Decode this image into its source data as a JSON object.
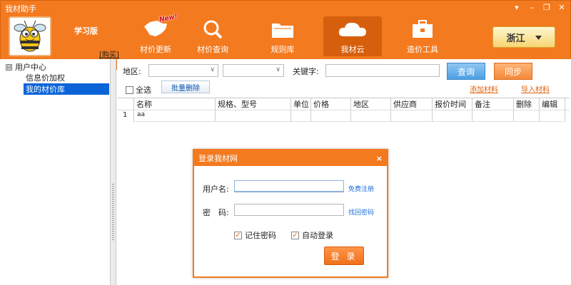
{
  "app": {
    "title": "我材助手",
    "edition": "学习版",
    "buy_label": "[购买]"
  },
  "window": {
    "controls": [
      "▾",
      "–",
      "❐",
      "✕"
    ]
  },
  "nav": [
    {
      "label": "材价更新",
      "icon": "china-map-icon",
      "badge": "New!"
    },
    {
      "label": "材价查询",
      "icon": "search-icon"
    },
    {
      "label": "规则库",
      "icon": "folder-icon"
    },
    {
      "label": "我材云",
      "icon": "cloud-icon",
      "active": true
    },
    {
      "label": "造价工具",
      "icon": "toolbox-icon"
    }
  ],
  "region": {
    "value": "浙江"
  },
  "sidebar": {
    "root": {
      "toggle": "⊟",
      "label": "用户中心"
    },
    "items": [
      {
        "label": "信息价加权"
      },
      {
        "label": "我的材价库",
        "selected": true
      }
    ]
  },
  "toolbar": {
    "region_label": "地区:",
    "keyword_label": "关键字:",
    "query_label": "查询",
    "sync_label": "同步",
    "select_all_label": "全选",
    "batch_delete_label": "批量删除",
    "add_material_label": "添加材料",
    "import_material_label": "导入材料"
  },
  "grid": {
    "columns": [
      "名称",
      "规格、型号",
      "单位",
      "价格",
      "地区",
      "供应商",
      "报价时间",
      "备注",
      "删除",
      "编辑"
    ],
    "rows": [
      {
        "no": "1",
        "name": "aa"
      }
    ]
  },
  "login": {
    "title": "登录我材网",
    "close": "×",
    "username_label": "用户名:",
    "password_label": "密　码:",
    "register_link": "免费注册",
    "forgot_link": "找回密码",
    "remember_label": "记住密码",
    "auto_login_label": "自动登录",
    "login_label": "登 录",
    "remember_checked": "✓",
    "auto_checked": "✓"
  },
  "colors": {
    "brand": "#f47a1f",
    "selection": "#0a64d8",
    "link": "#1a6fd8"
  }
}
